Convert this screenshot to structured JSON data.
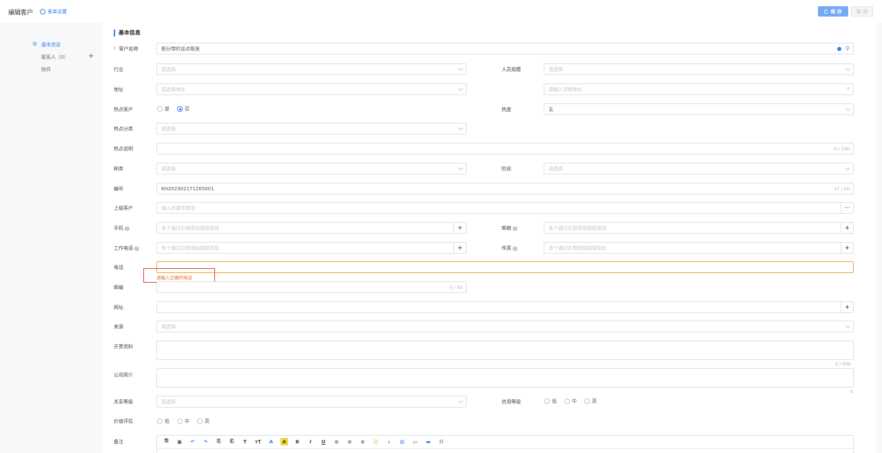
{
  "header": {
    "title": "编辑客户",
    "form_settings": "表单设置",
    "save": "保 存",
    "cancel": "取 消"
  },
  "nav": {
    "items": [
      {
        "label": "基本信息",
        "active": true
      },
      {
        "label": "联系人（0）",
        "add": "+"
      },
      {
        "label": "附件"
      }
    ]
  },
  "section": {
    "title": "基本信息"
  },
  "colors": {
    "accent": "#2f7ef6",
    "error": "#e53935",
    "warning": "#e6731e"
  },
  "fields": {
    "customer_name": {
      "label": "客户名称",
      "required": "*",
      "value": "假分带的谈点贩发"
    },
    "industry": {
      "label": "行业",
      "placeholder": "请选择"
    },
    "staff_size": {
      "label": "人员规模",
      "placeholder": "请选择"
    },
    "address": {
      "label": "地址",
      "placeholder": "请选择地址"
    },
    "address_detail": {
      "placeholder": "请输入详细地址"
    },
    "hot_customer": {
      "label": "热点客户",
      "options": [
        "是",
        "否"
      ],
      "selected": "否"
    },
    "heat": {
      "label": "热度",
      "value": "无"
    },
    "hot_category": {
      "label": "热点分类",
      "placeholder": "请选择"
    },
    "hot_desc": {
      "label": "热点说明",
      "counter": "0 / 100"
    },
    "kind": {
      "label": "种类",
      "placeholder": "请选择"
    },
    "stage": {
      "label": "阶段",
      "placeholder": "请选择"
    },
    "code": {
      "label": "编号",
      "value": "KH202302171265001",
      "counter": "17 / 50"
    },
    "parent": {
      "label": "上级客户",
      "placeholder": "输入关键字查询",
      "more": "···"
    },
    "mobile": {
      "label": "手机",
      "placeholder": "多个通过右侧添加按钮添加",
      "add": "+"
    },
    "email": {
      "label": "邮箱",
      "placeholder": "多个通过右侧添加按钮添加",
      "add": "+"
    },
    "work_phone": {
      "label": "工作电话",
      "placeholder": "多个通过右侧添加按钮添加",
      "add": "+"
    },
    "fax": {
      "label": "传真",
      "placeholder": "多个通过右侧添加按钮添加",
      "add": "+"
    },
    "phone": {
      "label": "电话",
      "error": "请输入正确的电话"
    },
    "postcode": {
      "label": "邮编",
      "counter": "0 / 50"
    },
    "website": {
      "label": "网址",
      "add": "+"
    },
    "source": {
      "label": "来源",
      "placeholder": "请选择"
    },
    "invoice": {
      "label": "开票资料",
      "counter": "0 / 500"
    },
    "intro": {
      "label": "公司简介",
      "counter": "0"
    },
    "relation_level": {
      "label": "关系等级",
      "placeholder": "请选择"
    },
    "credit_level": {
      "label": "信用等级",
      "options": [
        "低",
        "中",
        "高"
      ]
    },
    "value_rating": {
      "label": "价值评估",
      "options": [
        "低",
        "中",
        "高"
      ]
    },
    "remark": {
      "label": "备注"
    }
  },
  "editor_toolbar": [
    "🖫",
    "▣",
    "↶",
    "↷",
    "⎘",
    "⎗",
    "T",
    "тT",
    "A",
    "A",
    "B",
    "I",
    "U",
    "≡",
    "≡",
    "≡",
    "☺",
    "⇣",
    "▤",
    "▭",
    "▬",
    "☷"
  ]
}
